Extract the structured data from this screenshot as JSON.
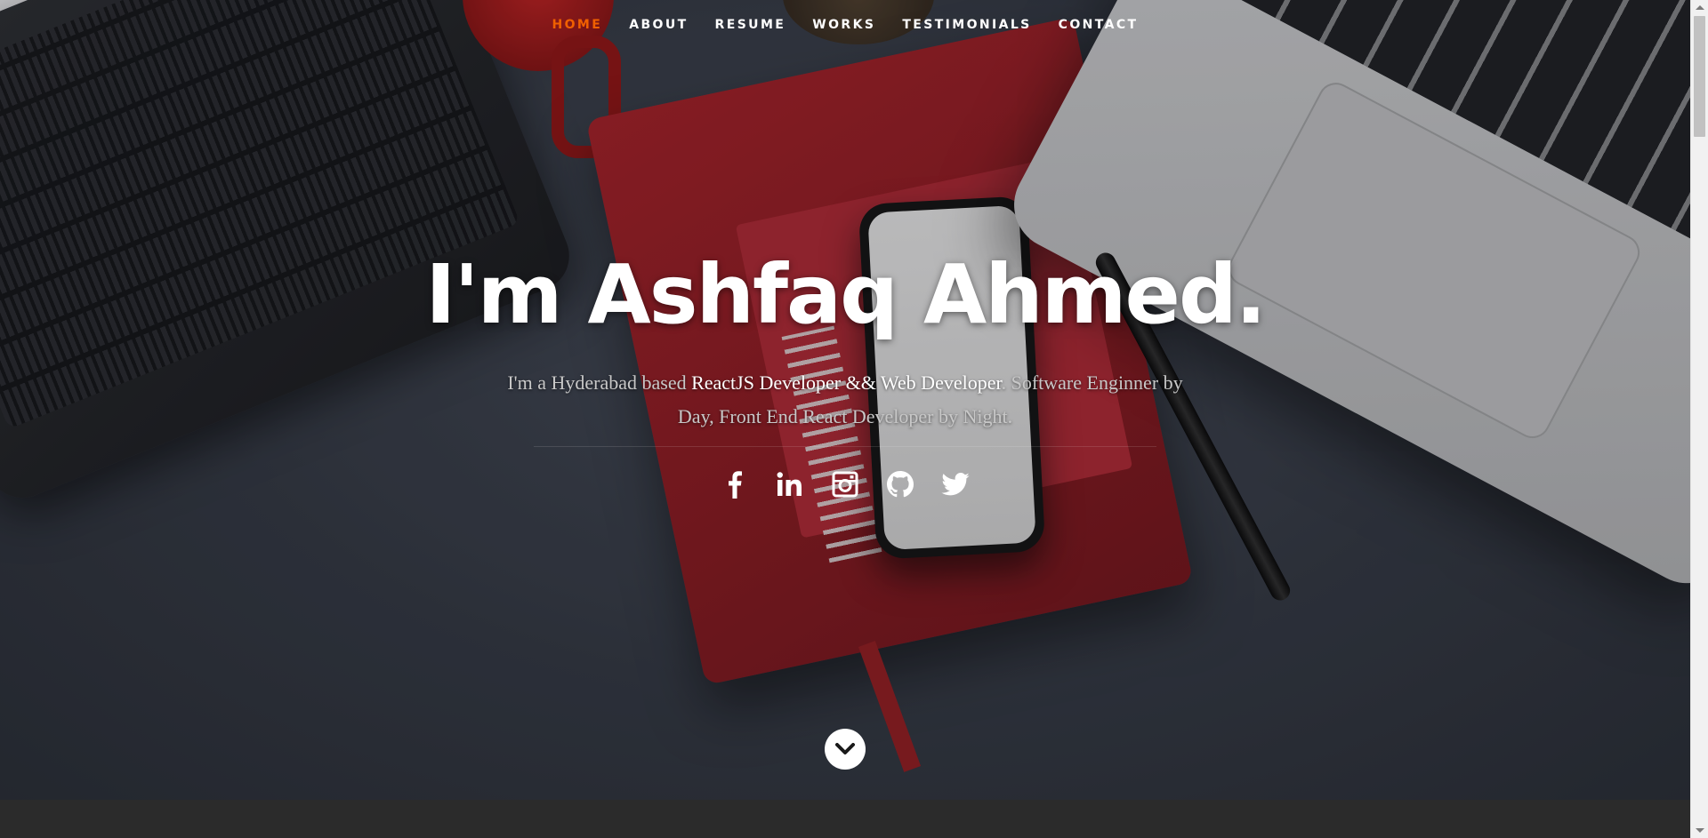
{
  "nav": {
    "items": [
      {
        "label": "HOME",
        "active": true
      },
      {
        "label": "ABOUT",
        "active": false
      },
      {
        "label": "RESUME",
        "active": false
      },
      {
        "label": "WORKS",
        "active": false
      },
      {
        "label": "TESTIMONIALS",
        "active": false
      },
      {
        "label": "CONTACT",
        "active": false
      }
    ],
    "active_color": "#f06000"
  },
  "banner": {
    "headline": "I'm Ashfaq Ahmed.",
    "tagline": {
      "part1": "I'm a Hyderabad based ",
      "highlight": "ReactJS Developer && Web Developer",
      "part2": ". Software Enginner by Day, Front End React Developer by Night."
    }
  },
  "social": [
    {
      "name": "facebook-icon"
    },
    {
      "name": "linkedin-icon"
    },
    {
      "name": "instagram-icon"
    },
    {
      "name": "github-icon"
    },
    {
      "name": "twitter-icon"
    }
  ],
  "scroll_down": {
    "icon": "chevron-down-icon"
  }
}
